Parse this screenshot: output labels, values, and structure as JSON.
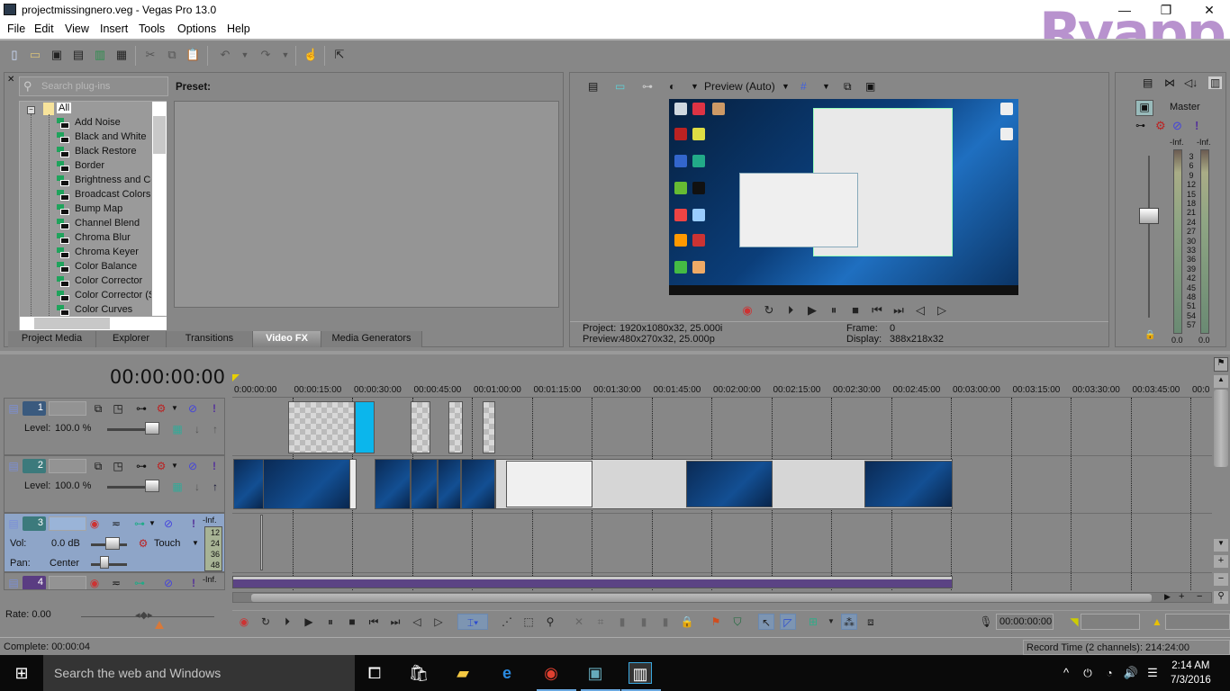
{
  "window": {
    "title": "projectmissingnero.veg - Vegas Pro 13.0",
    "watermark": "Ryapp",
    "controls": {
      "minimize": "—",
      "restore": "❐",
      "close": "✕"
    }
  },
  "menu": [
    "File",
    "Edit",
    "View",
    "Insert",
    "Tools",
    "Options",
    "Help"
  ],
  "toolbar": {
    "icons": [
      "new-project",
      "open",
      "save",
      "save-as",
      "render-as",
      "properties",
      "cut",
      "copy",
      "paste",
      "undo",
      "redo",
      "enable-snapping",
      "whats-this-help"
    ]
  },
  "fx_panel": {
    "search_placeholder": "Search plug-ins",
    "tree_root": "All",
    "plugins": [
      "Add Noise",
      "Black and White",
      "Black Restore",
      "Border",
      "Brightness and Contrast",
      "Broadcast Colors",
      "Bump Map",
      "Channel Blend",
      "Chroma Blur",
      "Chroma Keyer",
      "Color Balance",
      "Color Corrector",
      "Color Corrector (Secondary)",
      "Color Curves"
    ],
    "preset_label": "Preset:",
    "tabs": [
      "Project Media",
      "Explorer",
      "Transitions",
      "Video FX",
      "Media Generators"
    ],
    "active_tab": "Video FX"
  },
  "preview": {
    "quality": "Preview (Auto)",
    "project_label": "Project:",
    "project_value": "1920x1080x32, 25.000i",
    "preview_label": "Preview:",
    "preview_value": "480x270x32, 25.000p",
    "frame_label": "Frame:",
    "frame_value": "0",
    "display_label": "Display:",
    "display_value": "388x218x32"
  },
  "master": {
    "label": "Master",
    "peak_left": "-Inf.",
    "peak_right": "-Inf.",
    "scale": [
      "3",
      "6",
      "9",
      "12",
      "15",
      "18",
      "21",
      "24",
      "27",
      "30",
      "33",
      "36",
      "39",
      "42",
      "45",
      "48",
      "51",
      "54",
      "57"
    ],
    "value_left": "0.0",
    "value_right": "0.0"
  },
  "timeline": {
    "timecode": "00:00:00:00",
    "ruler": [
      "0:00:00:00",
      "00:00:15:00",
      "00:00:30:00",
      "00:00:45:00",
      "00:01:00:00",
      "00:01:15:00",
      "00:01:30:00",
      "00:01:45:00",
      "00:02:00:00",
      "00:02:15:00",
      "00:02:30:00",
      "00:02:45:00",
      "00:03:00:00",
      "00:03:15:00",
      "00:03:30:00",
      "00:03:45:00",
      "00:0"
    ],
    "tracks": [
      {
        "num": "1",
        "type": "video",
        "level_label": "Level:",
        "level": "100.0 %",
        "color": "#3a5a7e"
      },
      {
        "num": "2",
        "type": "video",
        "level_label": "Level:",
        "level": "100.0 %",
        "color": "#3c7a7c"
      },
      {
        "num": "3",
        "type": "audio",
        "vol_label": "Vol:",
        "vol": "0.0 dB",
        "pan_label": "Pan:",
        "pan": "Center",
        "automation": "Touch",
        "peak": "-Inf.",
        "meter_scale": [
          "12",
          "24",
          "36",
          "48"
        ],
        "color": "#3c7a7c"
      },
      {
        "num": "4",
        "type": "audio",
        "peak": "-Inf.",
        "color": "#5a3c82"
      }
    ]
  },
  "bottom": {
    "rate": "Rate: 0.00",
    "cursor_time": "00:00:00:00",
    "complete": "Complete: 00:00:04",
    "record_time": "Record Time (2 channels): 214:24:00"
  },
  "taskbar": {
    "search": "Search the web and Windows",
    "time": "2:14 AM",
    "date": "7/3/2016"
  }
}
